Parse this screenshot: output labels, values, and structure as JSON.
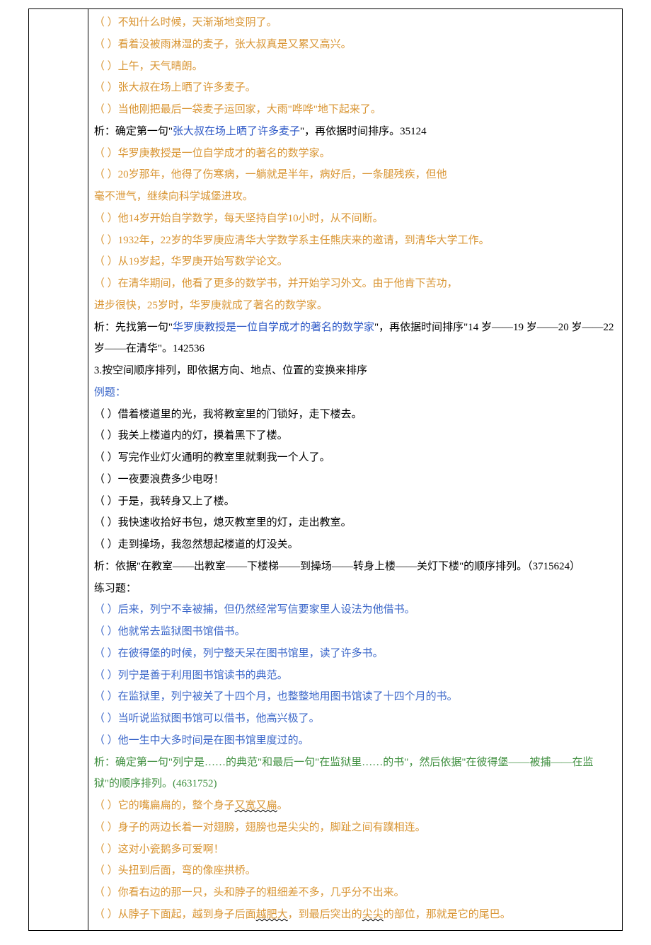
{
  "colors": {
    "blue": "#3a66c9",
    "blueLink": "#2a56c6",
    "orange": "#d99533",
    "green": "#3f8f3f"
  },
  "set1": {
    "s1": "（     ）不知什么时候，天渐渐地变阴了。",
    "s2": "（     ）看着没被雨淋湿的麦子，张大叔真是又累又高兴。",
    "s3": "（     ）上午，天气晴朗。",
    "s4": "（     ）张大叔在场上晒了许多麦子。",
    "s5": "（     ）当他刚把最后一袋麦子运回家，大雨\"哗哗\"地下起来了。",
    "xi_a": "析：确定第一句\"",
    "xi_b": "张大叔在场上晒了许多麦子",
    "xi_c": "\"，再依据时间排序。35124"
  },
  "set2": {
    "s1": "（     ）华罗庚教授是一位自学成才的著名的数学家。",
    "s2": "（     ）20岁那年，他得了伤寒病，一躺就是半年，病好后，一条腿残疾，但他",
    "s2b": "毫不泄气，继续向科学城堡进攻。",
    "s3": "（     ）他14岁开始自学数学，每天坚持自学10小时，从不间断。",
    "s4": "（     ）1932年，22岁的华罗庚应清华大学数学系主任熊庆来的邀请，到清华大学工作。",
    "s5": "（     ）从19岁起，华罗庚开始写数学论文。",
    "s6": "（     ）在清华期间，他看了更多的数学书，并开始学习外文。由于他肯下苦功，",
    "s6b": "进步很快，25岁时，华罗庚就成了著名的数学家。",
    "xi_a": "析：先找第一句\"",
    "xi_b": "华罗庚教授是一位自学成才的著名的数学家",
    "xi_c": "\"，再依据时间排序\"14 岁——19 岁——20 岁——22 岁——在清华\"。142536"
  },
  "heading3": "3.按空间顺序排列，即依据方向、地点、位置的变换来排序",
  "example_label": "例题：",
  "set3": {
    "s1": "（     ）借着楼道里的光，我将教室里的门锁好，走下楼去。",
    "s2": "（     ）我关上楼道内的灯，摸着黑下了楼。",
    "s3": "（     ）写完作业灯火通明的教室里就剩我一个人了。",
    "s4": "（     ）一夜要浪费多少电呀！",
    "s5": "（     ）于是，我转身又上了楼。",
    "s6": "（     ）我快速收拾好书包，熄灭教室里的灯，走出教室。",
    "s7": "（     ）走到操场，我忽然想起楼道的灯没关。",
    "xi": "析：依据\"在教室——出教室——下楼梯——到操场——转身上楼——关灯下楼\"的顺序排列。（3715624）"
  },
  "practice_label": "练习题：",
  "set4": {
    "s1": "（     ）后来，列宁不幸被捕，但仍然经常写信要家里人设法为他借书。",
    "s2": "（     ）他就常去监狱图书馆借书。",
    "s3": "（     ）在彼得堡的时候，列宁整天呆在图书馆里，读了许多书。",
    "s4": "（     ）列宁是善于利用图书馆读书的典范。",
    "s5": "（     ）在监狱里，列宁被关了十四个月，也整整地用图书馆读了十四个月的书。",
    "s6": "（     ）当听说监狱图书馆可以借书，他高兴极了。",
    "s7": "（     ）他一生中大多时间是在图书馆里度过的。",
    "xi": "析：确定第一句\"列宁是……的典范\"和最后一句\"在监狱里……的书\"，然后依据\"在彼得堡——被捕——在监狱\"的顺序排列。(4631752)"
  },
  "set5": {
    "s1a": "（   ）它的嘴扁扁的，整个身子",
    "s1b": "又宽又扁",
    "s1c": "。",
    "s2": "（   ）身子的两边长着一对翅膀，翅膀也是尖尖的，脚趾之间有蹼相连。",
    "s3": "（   ）这对小瓷鹅多可爱啊！",
    "s4": "（   ）头扭到后面，弯的像座拱桥。",
    "s5": "（   ）你看右边的那一只，头和脖子的粗细差不多，几乎分不出来。",
    "s6a": "（   ）从脖子下面起，越到身子后面",
    "s6b": "越肥大",
    "s6c": "，到最后突出的",
    "s6d": "尖尖",
    "s6e": "的部位，那就是它的尾巴。"
  }
}
